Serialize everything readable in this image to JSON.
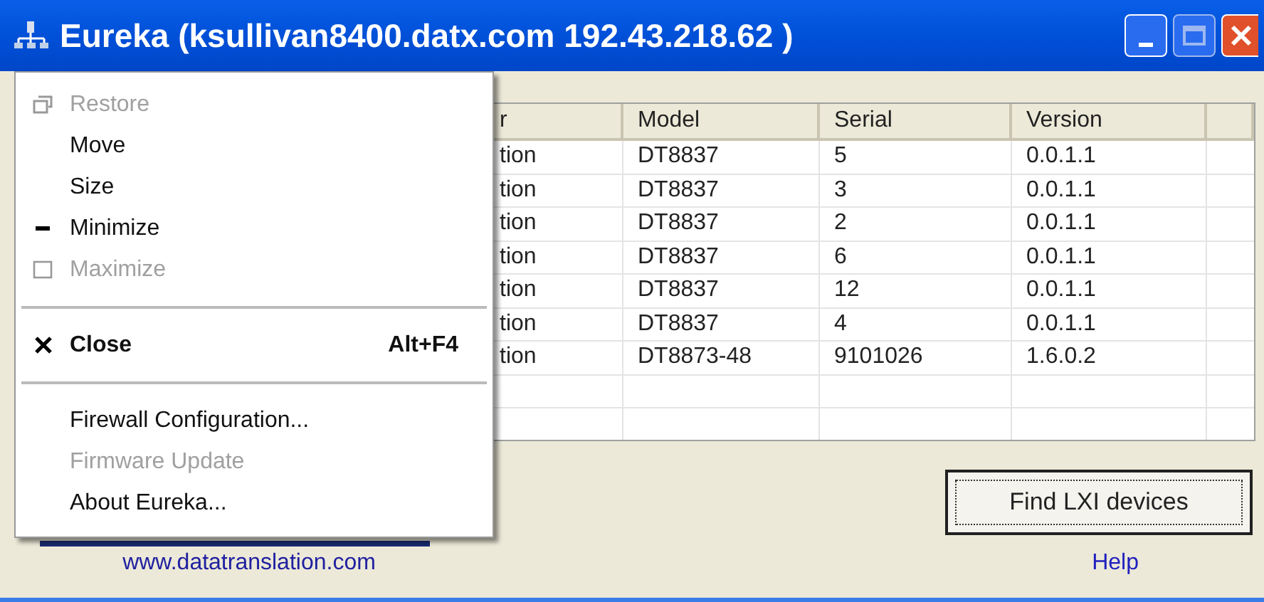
{
  "window": {
    "title": "Eureka (ksullivan8400.datx.com 192.43.218.62 )"
  },
  "system_menu": [
    {
      "kind": "restore",
      "label": "Restore",
      "disabled": true
    },
    {
      "kind": "item",
      "label": "Move",
      "disabled": false
    },
    {
      "kind": "item",
      "label": "Size",
      "disabled": false
    },
    {
      "kind": "minimize",
      "label": "Minimize",
      "disabled": false
    },
    {
      "kind": "maximize",
      "label": "Maximize",
      "disabled": true
    },
    {
      "kind": "separator"
    },
    {
      "kind": "close",
      "label": "Close",
      "shortcut": "Alt+F4",
      "disabled": false,
      "bold": true
    },
    {
      "kind": "separator"
    },
    {
      "kind": "item",
      "label": "Firewall Configuration...",
      "disabled": false
    },
    {
      "kind": "item",
      "label": "Firmware Update",
      "disabled": true
    },
    {
      "kind": "item",
      "label": "About Eureka...",
      "disabled": false
    }
  ],
  "table": {
    "columns": [
      "r",
      "Model",
      "Serial",
      "Version"
    ],
    "rows": [
      [
        "tion",
        "DT8837",
        "5",
        "0.0.1.1"
      ],
      [
        "tion",
        "DT8837",
        "3",
        "0.0.1.1"
      ],
      [
        "tion",
        "DT8837",
        "2",
        "0.0.1.1"
      ],
      [
        "tion",
        "DT8837",
        "6",
        "0.0.1.1"
      ],
      [
        "tion",
        "DT8837",
        "12",
        "0.0.1.1"
      ],
      [
        "tion",
        "DT8837",
        "4",
        "0.0.1.1"
      ],
      [
        "tion",
        "DT8873-48",
        "9101026",
        "1.6.0.2"
      ]
    ]
  },
  "website_link": "www.datatranslation.com",
  "find_button": "Find LXI devices",
  "help_link": "Help"
}
